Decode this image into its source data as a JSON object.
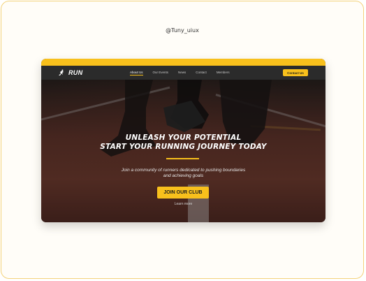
{
  "handle": "@Tuny_uiux",
  "brand": {
    "name": "RUN",
    "icon": "runner-logo-icon"
  },
  "nav": {
    "items": [
      {
        "label": "About Us",
        "active": true
      },
      {
        "label": "Our Events",
        "active": false
      },
      {
        "label": "News",
        "active": false
      },
      {
        "label": "Contact",
        "active": false
      },
      {
        "label": "Members",
        "active": false
      }
    ],
    "cta_label": "Contact Us"
  },
  "hero": {
    "headline_line1": "UNLEASH YOUR POTENTIAL",
    "headline_line2": "START YOUR RUNNING JOURNEY TODAY",
    "subtitle_line1": "Join a community of runners dedicated to pushing boundaries",
    "subtitle_line2": "and achieving goals",
    "cta_label": "JOIN OUR CLUB",
    "secondary_link": "Learn more"
  },
  "colors": {
    "accent": "#f8c01c",
    "navbar": "#2b2b2b",
    "frame_border": "#f3d27a"
  }
}
